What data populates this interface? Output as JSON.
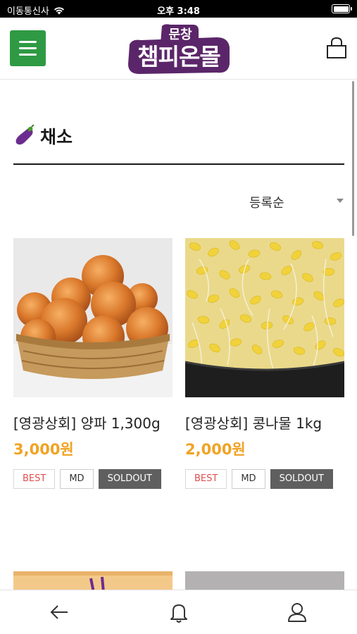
{
  "status_bar": {
    "carrier": "이동통신사",
    "time": "오후 3:48"
  },
  "header": {
    "logo_line1": "문창",
    "logo_line2": "챔피온몰",
    "colors": {
      "menu_bg": "#2e9a44",
      "logo": "#5b2669"
    }
  },
  "category": {
    "icon": "eggplant-icon",
    "title": "채소"
  },
  "sort": {
    "selected": "등록순"
  },
  "products": [
    {
      "name": "[영광상회] 양파 1,300g",
      "price": "3,000원",
      "badges": [
        "BEST",
        "MD",
        "SOLDOUT"
      ]
    },
    {
      "name": "[영광상회] 콩나물 1kg",
      "price": "2,000원",
      "badges": [
        "BEST",
        "MD",
        "SOLDOUT"
      ]
    }
  ],
  "bottom_nav": {
    "items": [
      "back-arrow-icon",
      "bell-icon",
      "user-icon"
    ]
  },
  "colors": {
    "price": "#f0a323",
    "best_badge": "#e05050",
    "soldout_bg": "#5f5f5f"
  }
}
